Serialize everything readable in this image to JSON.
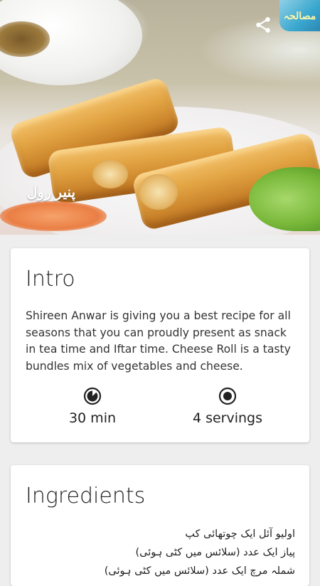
{
  "header": {
    "overlay_text": "پنیر رول",
    "logo_text": "مصالحہ",
    "share_icon": "share-icon"
  },
  "intro": {
    "title": "Intro",
    "description": "Shireen Anwar is giving you a best recipe for all seasons that you can proudly present as snack in tea time and Iftar time. Cheese Roll is a tasty bundles mix of vegetables and cheese.",
    "time": "30 min",
    "time_icon": "timer-icon",
    "servings": "4 servings",
    "servings_icon": "servings-icon"
  },
  "ingredients": {
    "title": "Ingredients",
    "items": [
      "اولیو آئل ایک چوتھائی کپ",
      "پیاز ایک عدد (سلائس میں کٹی ہوئی)",
      "شملہ مرچ ایک عدد (سلائس میں کٹی ہوئی)"
    ]
  }
}
